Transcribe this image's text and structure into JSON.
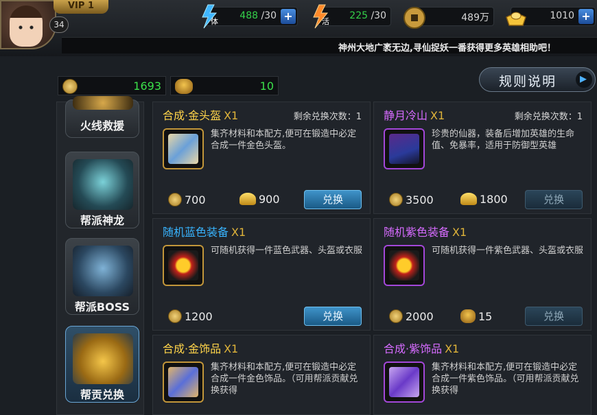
{
  "player": {
    "vip": "VIP 1",
    "level": "34"
  },
  "resources": {
    "stamina": {
      "icon": "stamina-icon",
      "value": "488",
      "max": "/30"
    },
    "energy": {
      "icon": "energy-icon",
      "value": "225",
      "max": "/30"
    },
    "copper": {
      "icon": "copper-coin-icon",
      "value": "489万"
    },
    "gold": {
      "icon": "gold-ingot-icon",
      "value": "1010"
    }
  },
  "ticker": "神州大地广袤无边,寻仙捉妖一番获得更多英雄相助吧！",
  "currency": {
    "contribution": "1693",
    "badge": "10"
  },
  "rules_label": "规则说明",
  "tabs": [
    {
      "label": "火线救援"
    },
    {
      "label": "帮派神龙"
    },
    {
      "label": "帮派BOSS"
    },
    {
      "label": "帮贡兑换"
    }
  ],
  "cards": [
    {
      "title": "合成·金头盔",
      "mult": "X1",
      "remain": "剩余兑换次数：1",
      "desc": "集齐材料和本配方,便可在锻造中必定合成一件金色头盔。",
      "price1": "700",
      "price2": "900",
      "button": "兑换"
    },
    {
      "title": "静月冷山",
      "mult": "X1",
      "remain": "剩余兑换次数：1",
      "desc": "珍贵的仙器，装备后增加英雄的生命值、免暴率，适用于防御型英雄",
      "price1": "3500",
      "price2": "1800",
      "button": "兑换"
    },
    {
      "title": "随机蓝色装备",
      "mult": "X1",
      "desc": "可随机获得一件蓝色武器、头盔或衣服",
      "price1": "1200",
      "button": "兑换"
    },
    {
      "title": "随机紫色装备",
      "mult": "X1",
      "desc": "可随机获得一件紫色武器、头盔或衣服",
      "price1": "2000",
      "price2": "15",
      "button": "兑换"
    },
    {
      "title": "合成·金饰品",
      "mult": "X1",
      "desc": "集齐材料和本配方,便可在锻造中必定合成一件金色饰品。（可用帮派贡献兑换获得"
    },
    {
      "title": "合成·紫饰品",
      "mult": "X1",
      "desc": "集齐材料和本配方,便可在锻造中必定合成一件紫色饰品。（可用帮派贡献兑换获得"
    }
  ]
}
